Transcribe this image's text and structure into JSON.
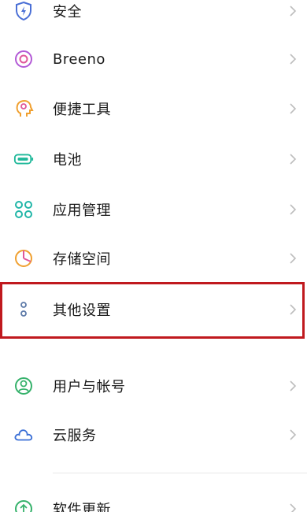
{
  "settings": {
    "items": [
      {
        "label": "安全",
        "icon": "shield-bolt-icon"
      },
      {
        "label": "Breeno",
        "icon": "breeno-ring-icon"
      },
      {
        "label": "便捷工具",
        "icon": "head-tools-icon"
      },
      {
        "label": "电池",
        "icon": "battery-icon"
      },
      {
        "label": "应用管理",
        "icon": "app-grid-icon"
      },
      {
        "label": "存储空间",
        "icon": "pie-storage-icon"
      },
      {
        "label": "其他设置",
        "icon": "more-dots-icon"
      },
      {
        "label": "用户与帐号",
        "icon": "user-account-icon"
      },
      {
        "label": "云服务",
        "icon": "cloud-icon"
      },
      {
        "label": "软件更新",
        "icon": "update-arrow-icon"
      }
    ]
  },
  "colors": {
    "highlight": "#c0191e",
    "shield": "#4a6fd6",
    "breeno": "#b35ad6",
    "tools": "#f0a030",
    "battery": "#1fb89a",
    "apps": "#21b6a8",
    "storage": "#f0a030",
    "other": "#5d7aa8",
    "user": "#37b26c",
    "cloud": "#3a6fd6",
    "update": "#37b26c"
  }
}
